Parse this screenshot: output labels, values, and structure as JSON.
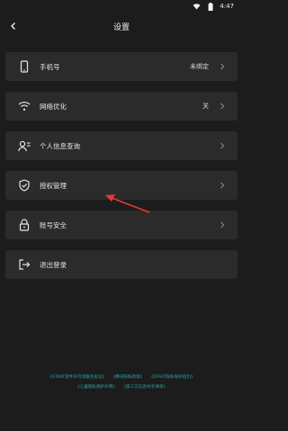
{
  "status": {
    "time": "4:47"
  },
  "header": {
    "title": "设置"
  },
  "menu": [
    {
      "label": "手机号",
      "value": "未绑定",
      "icon": "phone-icon"
    },
    {
      "label": "网络优化",
      "value": "关",
      "icon": "wifi-icon"
    },
    {
      "label": "个人信息查询",
      "value": "",
      "icon": "user-info-icon"
    },
    {
      "label": "授权管理",
      "value": "",
      "icon": "shield-check-icon"
    },
    {
      "label": "账号安全",
      "value": "",
      "icon": "lock-icon"
    },
    {
      "label": "退出登录",
      "value": "",
      "icon": "logout-icon"
    }
  ],
  "footer": {
    "links": [
      "《START软件许可及服务协议》",
      "《腾讯隐私政策》",
      "《START隐私保护指引》",
      "《儿童隐私保护声明》",
      "《第三方信息共享清单》"
    ]
  },
  "colors": {
    "background": "#1c1c1c",
    "row": "#2b2b2b",
    "link": "#2aa6a6",
    "arrow": "#e53935"
  }
}
